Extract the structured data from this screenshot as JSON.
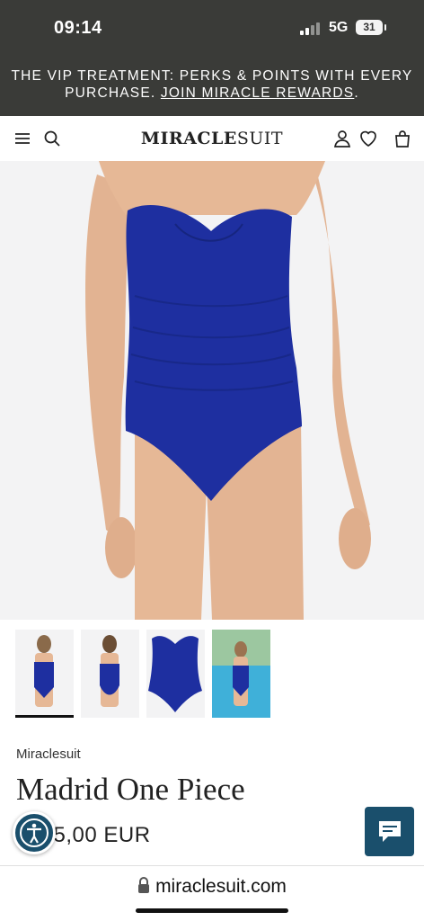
{
  "status_bar": {
    "time": "09:14",
    "network": "5G",
    "battery": "31"
  },
  "promo": {
    "text": "THE VIP TREATMENT: PERKS & POINTS WITH EVERY PURCHASE. ",
    "link": "JOIN MIRACLE REWARDS",
    "end": "."
  },
  "nav": {
    "logo_bold": "MIRACLE",
    "logo_light": "SUIT"
  },
  "product": {
    "brand": "Miraclesuit",
    "name": "Madrid One Piece",
    "price": "$165,00 EUR"
  },
  "thumbnails": [
    "model front",
    "model back",
    "product flat",
    "model pool"
  ],
  "browser": {
    "url": "miraclesuit.com"
  },
  "colors": {
    "swimsuit": "#1e2fa0",
    "skin": "#e6b896",
    "dark_bar": "#3a3b38",
    "accent": "#1a4f6c"
  }
}
